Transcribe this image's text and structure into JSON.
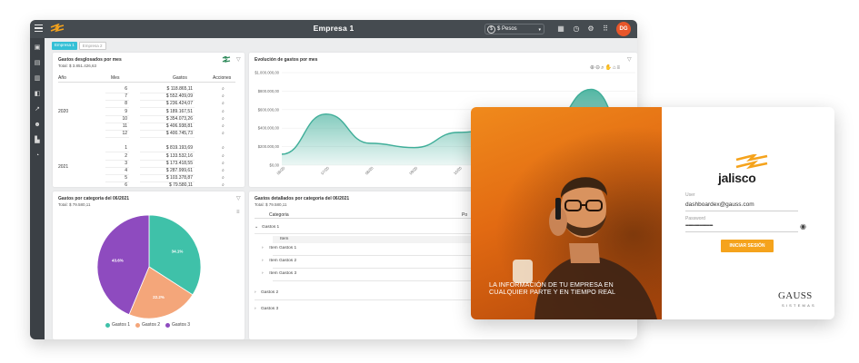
{
  "app": {
    "title": "Empresa 1",
    "currency": {
      "symbol": "$",
      "label": "$ Pesos"
    },
    "avatar": "DG",
    "accent": "#35c0d6",
    "brand_orange": "#f5a31c"
  },
  "company_tabs": [
    "Empresa 1",
    "Empresa 2"
  ],
  "sidebar_icons": [
    "dashboard-icon",
    "report-icon",
    "document-icon",
    "wallet-icon",
    "trend-icon",
    "users-icon",
    "building-icon",
    "timer-icon"
  ],
  "monthly_table": {
    "title": "Gastos desglosados por mes",
    "total": "Total: $ 3.851.426,63",
    "columns": [
      "Año",
      "Mes",
      "Gastos",
      "Acciones"
    ],
    "groups": [
      {
        "year": "2020",
        "rows": [
          {
            "mes": "6",
            "gasto": "$ 118.865,11"
          },
          {
            "mes": "7",
            "gasto": "$ 552.409,09"
          },
          {
            "mes": "8",
            "gasto": "$ 236.424,07"
          },
          {
            "mes": "9",
            "gasto": "$ 189.167,51"
          },
          {
            "mes": "10",
            "gasto": "$ 354.073,26"
          },
          {
            "mes": "11",
            "gasto": "$ 406.938,81"
          },
          {
            "mes": "12",
            "gasto": "$ 400.745,73"
          }
        ]
      },
      {
        "year": "2021",
        "rows": [
          {
            "mes": "1",
            "gasto": "$ 819.193,69"
          },
          {
            "mes": "2",
            "gasto": "$ 133.532,16"
          },
          {
            "mes": "3",
            "gasto": "$ 173.418,55"
          },
          {
            "mes": "4",
            "gasto": "$ 287.999,61"
          },
          {
            "mes": "5",
            "gasto": "$ 103.378,87"
          },
          {
            "mes": "6",
            "gasto": "$ 79.580,11"
          }
        ]
      }
    ]
  },
  "chart_data": [
    {
      "type": "area",
      "title": "Evolución de gastos por mes",
      "x": [
        "06/20",
        "07/20",
        "08/20",
        "09/20",
        "10/20",
        "11/20",
        "12/20",
        "01/21",
        "02/21"
      ],
      "series": [
        {
          "values": [
            118865,
            552409,
            236424,
            189167,
            354073,
            406938,
            400745,
            819193,
            133532
          ]
        }
      ],
      "y_ticks": [
        "$1.000.000,00",
        "$800.000,00",
        "$600.000,00",
        "$400.000,00",
        "$200.000,00",
        "$0,00"
      ],
      "ylim": [
        0,
        1000000
      ],
      "color": "#3fae99",
      "grid": true
    },
    {
      "type": "pie",
      "title": "Gastos por categoria del 06/2021",
      "subtitle": "Total: $ 79.580,11",
      "slices": [
        {
          "name": "Gastos 1",
          "value": 34.1,
          "label": "34.1%",
          "color": "#3fc1a9"
        },
        {
          "name": "Gastos 2",
          "value": 22.2,
          "label": "22.2%",
          "color": "#f4a67a"
        },
        {
          "name": "Gastos 3",
          "value": 43.7,
          "label": "43.6%",
          "color": "#8e4bbf"
        }
      ],
      "legend": "bottom"
    }
  ],
  "detail": {
    "title": "Gastos detallados por categoria del 06/2021",
    "total": "Total: $ 79.580,11",
    "col_categoria": "Categoria",
    "col_p": "Po",
    "col_item": "Item",
    "categories": [
      "Gastos 1",
      "Gastos 2",
      "Gastos 3"
    ],
    "items": [
      "Item Gastos 1",
      "Item Gastos 2",
      "Item Gastos 3"
    ]
  },
  "login": {
    "tagline": "La información de tu empresa en cualquier parte y en tiempo real",
    "brand": "jalisco",
    "user_label": "User",
    "user_value": "dashboardex@gauss.com",
    "pass_label": "Password",
    "pass_value": "••••••••••••••••••••••••••",
    "signin": "INICIAR SESIÓN",
    "vendor": "GAUSS",
    "vendor_sub": "SISTEMAS"
  }
}
